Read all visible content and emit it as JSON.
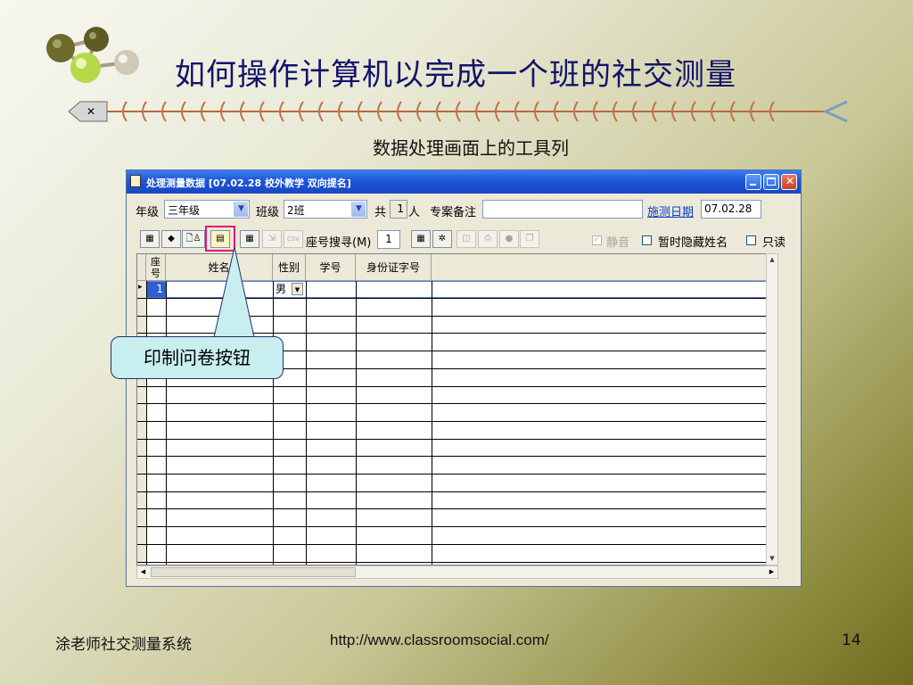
{
  "slide": {
    "title": "如何操作计算机以完成一个班的社交测量",
    "subtitle": "数据处理画面上的工具列",
    "footer_left": "涂老师社交测量系统",
    "footer_url": "http://www.classroomsocial.com/",
    "page_number": "14"
  },
  "window": {
    "title": "处理测量数据 [07.02.28 校外教学 双向提名]",
    "grade_label": "年级",
    "grade_value": "三年级",
    "class_label": "班级",
    "class_value": "2班",
    "total_label": "共",
    "total_value": "1",
    "total_unit": "人",
    "notes_label": "专案备注",
    "notes_value": "",
    "date_label": "施测日期",
    "date_value": "07.02.28",
    "seat_search_label": "座号搜寻(M)",
    "seat_search_value": "1",
    "csv_icon_text": "CSV",
    "mute_label": "静音",
    "hide_names_label": "暂时隐藏姓名",
    "readonly_label": "只读"
  },
  "grid": {
    "columns": [
      "座号",
      "姓名",
      "性别",
      "学号",
      "身份证字号"
    ],
    "rows": [
      {
        "seat": "1",
        "name": "",
        "gender": "男",
        "student_id": "",
        "id_number": ""
      }
    ]
  },
  "callout": {
    "text": "印制问卷按钮"
  },
  "colors": {
    "title": "#13136b",
    "window_titlebar": "#1d56d8",
    "highlight_box": "#e0147a",
    "callout_fill": "#c8eef0"
  }
}
